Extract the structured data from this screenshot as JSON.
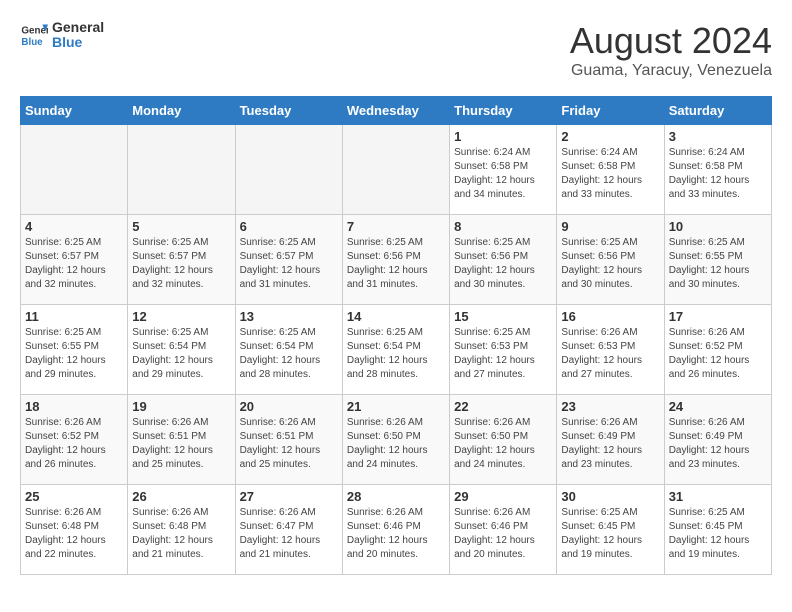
{
  "logo": {
    "general": "General",
    "blue": "Blue"
  },
  "title": {
    "month_year": "August 2024",
    "location": "Guama, Yaracuy, Venezuela"
  },
  "weekdays": [
    "Sunday",
    "Monday",
    "Tuesday",
    "Wednesday",
    "Thursday",
    "Friday",
    "Saturday"
  ],
  "weeks": [
    [
      {
        "day": "",
        "empty": true
      },
      {
        "day": "",
        "empty": true
      },
      {
        "day": "",
        "empty": true
      },
      {
        "day": "",
        "empty": true
      },
      {
        "day": "1",
        "sunrise": "6:24 AM",
        "sunset": "6:58 PM",
        "daylight": "12 hours and 34 minutes."
      },
      {
        "day": "2",
        "sunrise": "6:24 AM",
        "sunset": "6:58 PM",
        "daylight": "12 hours and 33 minutes."
      },
      {
        "day": "3",
        "sunrise": "6:24 AM",
        "sunset": "6:58 PM",
        "daylight": "12 hours and 33 minutes."
      }
    ],
    [
      {
        "day": "4",
        "sunrise": "6:25 AM",
        "sunset": "6:57 PM",
        "daylight": "12 hours and 32 minutes."
      },
      {
        "day": "5",
        "sunrise": "6:25 AM",
        "sunset": "6:57 PM",
        "daylight": "12 hours and 32 minutes."
      },
      {
        "day": "6",
        "sunrise": "6:25 AM",
        "sunset": "6:57 PM",
        "daylight": "12 hours and 31 minutes."
      },
      {
        "day": "7",
        "sunrise": "6:25 AM",
        "sunset": "6:56 PM",
        "daylight": "12 hours and 31 minutes."
      },
      {
        "day": "8",
        "sunrise": "6:25 AM",
        "sunset": "6:56 PM",
        "daylight": "12 hours and 30 minutes."
      },
      {
        "day": "9",
        "sunrise": "6:25 AM",
        "sunset": "6:56 PM",
        "daylight": "12 hours and 30 minutes."
      },
      {
        "day": "10",
        "sunrise": "6:25 AM",
        "sunset": "6:55 PM",
        "daylight": "12 hours and 30 minutes."
      }
    ],
    [
      {
        "day": "11",
        "sunrise": "6:25 AM",
        "sunset": "6:55 PM",
        "daylight": "12 hours and 29 minutes."
      },
      {
        "day": "12",
        "sunrise": "6:25 AM",
        "sunset": "6:54 PM",
        "daylight": "12 hours and 29 minutes."
      },
      {
        "day": "13",
        "sunrise": "6:25 AM",
        "sunset": "6:54 PM",
        "daylight": "12 hours and 28 minutes."
      },
      {
        "day": "14",
        "sunrise": "6:25 AM",
        "sunset": "6:54 PM",
        "daylight": "12 hours and 28 minutes."
      },
      {
        "day": "15",
        "sunrise": "6:25 AM",
        "sunset": "6:53 PM",
        "daylight": "12 hours and 27 minutes."
      },
      {
        "day": "16",
        "sunrise": "6:26 AM",
        "sunset": "6:53 PM",
        "daylight": "12 hours and 27 minutes."
      },
      {
        "day": "17",
        "sunrise": "6:26 AM",
        "sunset": "6:52 PM",
        "daylight": "12 hours and 26 minutes."
      }
    ],
    [
      {
        "day": "18",
        "sunrise": "6:26 AM",
        "sunset": "6:52 PM",
        "daylight": "12 hours and 26 minutes."
      },
      {
        "day": "19",
        "sunrise": "6:26 AM",
        "sunset": "6:51 PM",
        "daylight": "12 hours and 25 minutes."
      },
      {
        "day": "20",
        "sunrise": "6:26 AM",
        "sunset": "6:51 PM",
        "daylight": "12 hours and 25 minutes."
      },
      {
        "day": "21",
        "sunrise": "6:26 AM",
        "sunset": "6:50 PM",
        "daylight": "12 hours and 24 minutes."
      },
      {
        "day": "22",
        "sunrise": "6:26 AM",
        "sunset": "6:50 PM",
        "daylight": "12 hours and 24 minutes."
      },
      {
        "day": "23",
        "sunrise": "6:26 AM",
        "sunset": "6:49 PM",
        "daylight": "12 hours and 23 minutes."
      },
      {
        "day": "24",
        "sunrise": "6:26 AM",
        "sunset": "6:49 PM",
        "daylight": "12 hours and 23 minutes."
      }
    ],
    [
      {
        "day": "25",
        "sunrise": "6:26 AM",
        "sunset": "6:48 PM",
        "daylight": "12 hours and 22 minutes."
      },
      {
        "day": "26",
        "sunrise": "6:26 AM",
        "sunset": "6:48 PM",
        "daylight": "12 hours and 21 minutes."
      },
      {
        "day": "27",
        "sunrise": "6:26 AM",
        "sunset": "6:47 PM",
        "daylight": "12 hours and 21 minutes."
      },
      {
        "day": "28",
        "sunrise": "6:26 AM",
        "sunset": "6:46 PM",
        "daylight": "12 hours and 20 minutes."
      },
      {
        "day": "29",
        "sunrise": "6:26 AM",
        "sunset": "6:46 PM",
        "daylight": "12 hours and 20 minutes."
      },
      {
        "day": "30",
        "sunrise": "6:25 AM",
        "sunset": "6:45 PM",
        "daylight": "12 hours and 19 minutes."
      },
      {
        "day": "31",
        "sunrise": "6:25 AM",
        "sunset": "6:45 PM",
        "daylight": "12 hours and 19 minutes."
      }
    ]
  ]
}
